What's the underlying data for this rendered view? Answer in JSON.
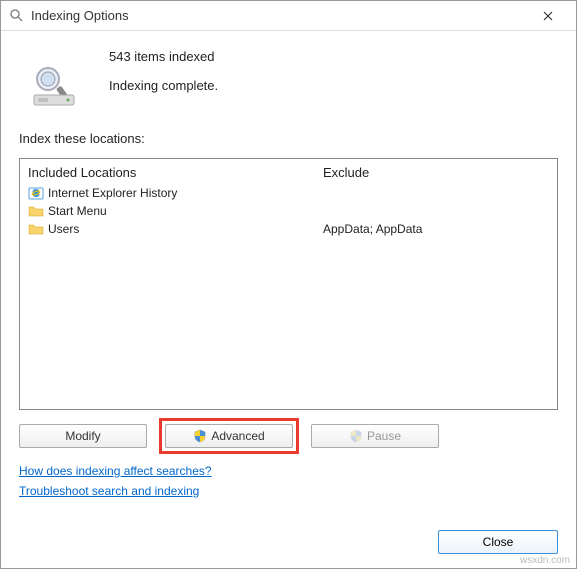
{
  "titlebar": {
    "title": "Indexing Options"
  },
  "status": {
    "items_indexed": "543 items indexed",
    "complete": "Indexing complete."
  },
  "section_label": "Index these locations:",
  "columns": {
    "included_header": "Included Locations",
    "exclude_header": "Exclude"
  },
  "locations": [
    {
      "icon": "ie",
      "label": "Internet Explorer History",
      "exclude": ""
    },
    {
      "icon": "folder",
      "label": "Start Menu",
      "exclude": ""
    },
    {
      "icon": "folder",
      "label": "Users",
      "exclude": "AppData; AppData"
    }
  ],
  "buttons": {
    "modify": "Modify",
    "advanced": "Advanced",
    "pause": "Pause",
    "close": "Close"
  },
  "links": {
    "how_affect": "How does indexing affect searches?",
    "troubleshoot": "Troubleshoot search and indexing"
  },
  "watermark": "wsxdn.com"
}
